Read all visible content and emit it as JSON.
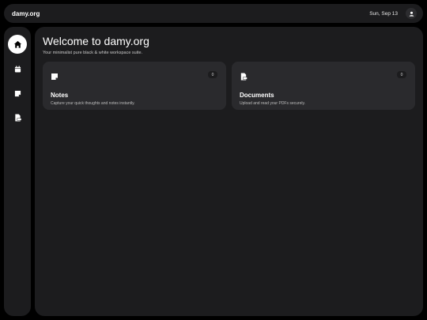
{
  "header": {
    "brand": "damy.org",
    "date": "Sun, Sep 13"
  },
  "sidebar": {
    "items": [
      {
        "name": "home",
        "icon": "home-icon",
        "active": true
      },
      {
        "name": "calendar",
        "icon": "calendar-icon",
        "active": false
      },
      {
        "name": "notes",
        "icon": "note-icon",
        "active": false
      },
      {
        "name": "documents",
        "icon": "pdf-file-icon",
        "active": false
      }
    ]
  },
  "main": {
    "title": "Welcome to damy.org",
    "subtitle": "Your minimalist pure black & white workspace suite.",
    "cards": [
      {
        "title": "Notes",
        "description": "Capture your quick thoughts and notes instantly.",
        "count": "0",
        "icon": "note-icon"
      },
      {
        "title": "Documents",
        "description": "Upload and read your PDFs securely.",
        "count": "0",
        "icon": "pdf-file-icon"
      }
    ]
  },
  "colors": {
    "background": "#000000",
    "surface": "#1c1c1e",
    "card": "#2a2a2d",
    "accent": "#ffffff"
  }
}
